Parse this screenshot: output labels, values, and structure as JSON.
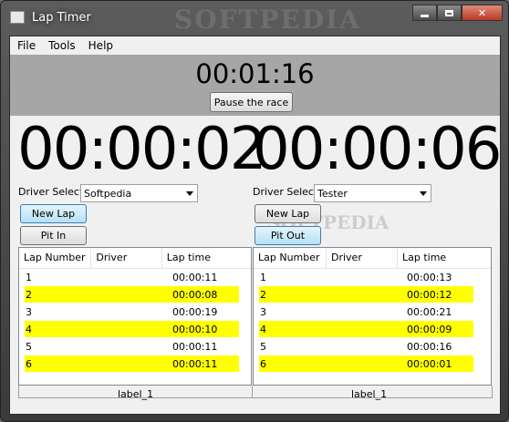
{
  "window": {
    "title": "Lap Timer",
    "watermark": "SOFTPEDIA"
  },
  "menu": [
    "File",
    "Tools",
    "Help"
  ],
  "race": {
    "time": "00:01:16",
    "pause_label": "Pause the race"
  },
  "timers": {
    "left": "00:00:02",
    "right": "00:00:06"
  },
  "left": {
    "driver_label": "Driver Select:",
    "driver_value": "Softpedia",
    "new_lap": "New Lap",
    "pit": "Pit In",
    "headers": [
      "Lap Number",
      "Driver",
      "Lap time"
    ],
    "laps": [
      {
        "n": "1",
        "t": "00:00:11",
        "highlight": false
      },
      {
        "n": "2",
        "t": "00:00:08",
        "highlight": true
      },
      {
        "n": "3",
        "t": "00:00:19",
        "highlight": false
      },
      {
        "n": "4",
        "t": "00:00:10",
        "highlight": true
      },
      {
        "n": "5",
        "t": "00:00:11",
        "highlight": false
      },
      {
        "n": "6",
        "t": "00:00:11",
        "highlight": true
      }
    ],
    "footer": "label_1"
  },
  "right": {
    "driver_label": "Driver Select:",
    "driver_value": "Tester",
    "new_lap": "New Lap",
    "pit": "Pit Out",
    "headers": [
      "Lap Number",
      "Driver",
      "Lap time"
    ],
    "laps": [
      {
        "n": "1",
        "t": "00:00:13",
        "highlight": false
      },
      {
        "n": "2",
        "t": "00:00:12",
        "highlight": true
      },
      {
        "n": "3",
        "t": "00:00:21",
        "highlight": false
      },
      {
        "n": "4",
        "t": "00:00:09",
        "highlight": true
      },
      {
        "n": "5",
        "t": "00:00:16",
        "highlight": false
      },
      {
        "n": "6",
        "t": "00:00:01",
        "highlight": true
      }
    ],
    "footer": "label_1"
  },
  "colors": {
    "highlight": "#ffff00",
    "race_panel": "#a6a6a6"
  }
}
